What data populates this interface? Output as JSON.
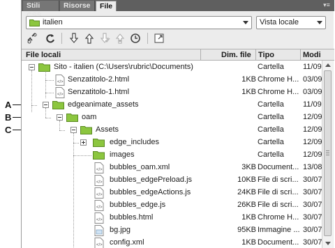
{
  "tabs": [
    {
      "label": "Stili CSS"
    },
    {
      "label": "Risorse"
    },
    {
      "label": "File"
    }
  ],
  "site_select": {
    "value": "italien"
  },
  "view_select": {
    "value": "Vista locale"
  },
  "columns": {
    "name": "File locali",
    "size": "Dim. file",
    "type": "Tipo",
    "modified": "Modi"
  },
  "rows": [
    {
      "name": "Sito - italien (C:\\Users\\rubric\\Documents)",
      "size": "",
      "type": "Cartella",
      "modified": "11/09"
    },
    {
      "name": "Senzatitolo-2.html",
      "size": "1KB",
      "type": "Chrome H...",
      "modified": "03/09"
    },
    {
      "name": "Senzatitolo-1.html",
      "size": "1KB",
      "type": "Chrome H...",
      "modified": "03/09"
    },
    {
      "name": "edgeanimate_assets",
      "size": "",
      "type": "Cartella",
      "modified": "11/09"
    },
    {
      "name": "oam",
      "size": "",
      "type": "Cartella",
      "modified": "12/09"
    },
    {
      "name": "Assets",
      "size": "",
      "type": "Cartella",
      "modified": "12/09"
    },
    {
      "name": "edge_includes",
      "size": "",
      "type": "Cartella",
      "modified": "12/09"
    },
    {
      "name": "images",
      "size": "",
      "type": "Cartella",
      "modified": "12/09"
    },
    {
      "name": "bubbles_oam.xml",
      "size": "3KB",
      "type": "Document...",
      "modified": "13/08"
    },
    {
      "name": "bubbles_edgePreload.js",
      "size": "10KB",
      "type": "File di scri...",
      "modified": "30/07"
    },
    {
      "name": "bubbles_edgeActions.js",
      "size": "24KB",
      "type": "File di scri...",
      "modified": "30/07"
    },
    {
      "name": "bubbles_edge.js",
      "size": "26KB",
      "type": "File di scri...",
      "modified": "30/07"
    },
    {
      "name": "bubbles.html",
      "size": "1KB",
      "type": "Chrome H...",
      "modified": "30/07"
    },
    {
      "name": "bg.jpg",
      "size": "95KB",
      "type": "Immagine ...",
      "modified": "30/07"
    },
    {
      "name": "config.xml",
      "size": "1KB",
      "type": "Document...",
      "modified": "30/07"
    }
  ],
  "callouts": [
    "A",
    "B",
    "C"
  ],
  "icons": {
    "folder": "folder-icon",
    "file": "file-icon",
    "connect": "connect-icon",
    "refresh": "refresh-icon",
    "get": "get-icon",
    "put": "put-icon",
    "checkout": "checkout-icon",
    "checkin": "checkin-icon",
    "sync": "sync-icon",
    "expand": "expand-icon"
  },
  "colors": {
    "folder": "#8cc63f",
    "tab_strip": "#5f5f5f",
    "panel_bg": "#ececec"
  }
}
